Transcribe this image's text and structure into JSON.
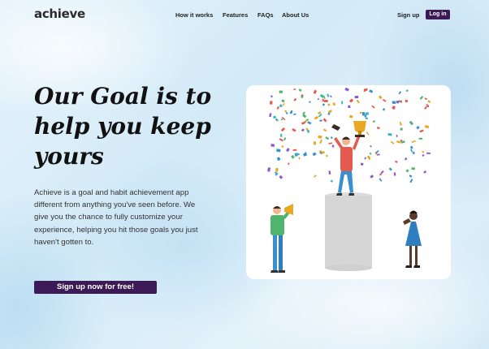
{
  "brand": {
    "logo": "achieve"
  },
  "nav": {
    "links": [
      "How it works",
      "Features",
      "FAQs",
      "About Us"
    ],
    "signup": "Sign up",
    "login": "Log in"
  },
  "hero": {
    "title": "Our Goal is to help you keep yours",
    "description": "Achieve is a goal and habit achievement app different from anything you've seen before. We give you the chance  to fully customize your experience, helping you hit those goals you just haven't gotten to.",
    "cta": "Sign up now for free!"
  },
  "colors": {
    "primary": "#3b1a55",
    "accent_red": "#e55a4e",
    "accent_blue": "#3a8fd0"
  },
  "illustration": {
    "icons": [
      "trophy-icon",
      "megaphone-icon",
      "podium-icon",
      "confetti"
    ]
  }
}
